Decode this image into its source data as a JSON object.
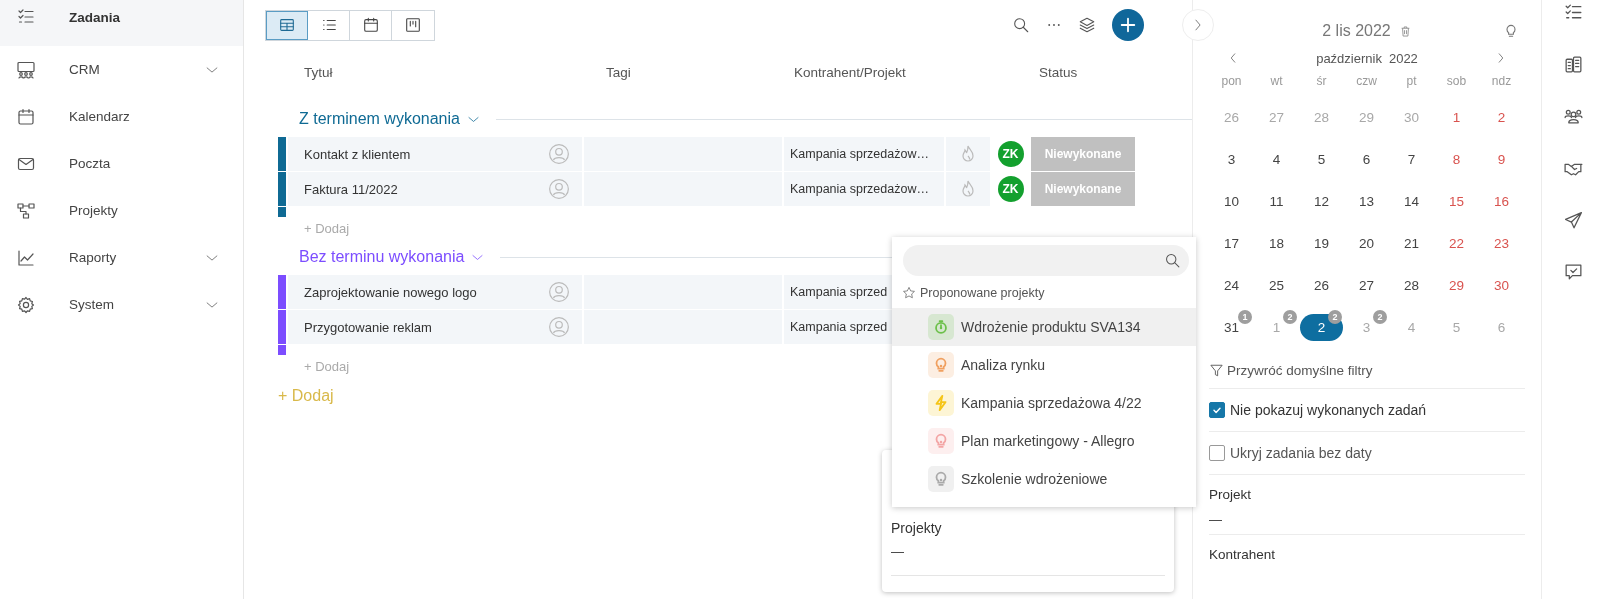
{
  "sidebar": {
    "items": [
      {
        "label": "Zadania",
        "kind": "link",
        "selected": true
      },
      {
        "label": "CRM",
        "kind": "group",
        "selected": false,
        "expanded": false
      },
      {
        "label": "Kalendarz",
        "kind": "link",
        "selected": false
      },
      {
        "label": "Poczta",
        "kind": "link",
        "selected": false
      },
      {
        "label": "Projekty",
        "kind": "link",
        "selected": false
      },
      {
        "label": "Raporty",
        "kind": "group",
        "selected": false,
        "expanded": false
      },
      {
        "label": "System",
        "kind": "group",
        "selected": false,
        "expanded": false
      }
    ]
  },
  "view_modes": [
    {
      "selected": true
    },
    {
      "selected": false
    },
    {
      "selected": false
    },
    {
      "selected": false
    }
  ],
  "table": {
    "columns": [
      "Tytuł",
      "Tagi",
      "Kontrahent/Projekt",
      "Status"
    ],
    "groups": [
      {
        "title": "Z terminem wykonania",
        "color": "#0f6a94",
        "add_label": "+ Dodaj",
        "rows": [
          {
            "title": "Kontakt z klientem",
            "contractor": "Kampania sprzedażow…",
            "assignee": "ZK",
            "status": "Niewykonane"
          },
          {
            "title": "Faktura 11/2022",
            "contractor": "Kampania sprzedażow…",
            "assignee": "ZK",
            "status": "Niewykonane"
          }
        ]
      },
      {
        "title": "Bez terminu wykonania",
        "color": "#7c4dff",
        "add_label": "+ Dodaj",
        "rows": [
          {
            "title": "Zaprojektowanie nowego logo",
            "contractor": "Kampania sprzed"
          },
          {
            "title": "Przygotowanie reklam",
            "contractor": "Kampania sprzed"
          }
        ]
      }
    ],
    "add_group_label": "+ Dodaj"
  },
  "project_card": {
    "label": "Projekty",
    "value": "—"
  },
  "project_picker": {
    "section_title": "Proponowane projekty",
    "items": [
      {
        "label": "Wdrożenie produktu SVA134",
        "kind": "timer",
        "color": "#6cc04a",
        "selected": true
      },
      {
        "label": "Analiza rynku",
        "kind": "bulb",
        "color": "#f0a060",
        "selected": false
      },
      {
        "label": "Kampania sprzedażowa 4/22",
        "kind": "bolt",
        "color": "#f5c518",
        "selected": false
      },
      {
        "label": "Plan marketingowy - Allegro",
        "kind": "bulb",
        "color": "#f3a5a5",
        "selected": false
      },
      {
        "label": "Szkolenie wdrożeniowe",
        "kind": "bulb",
        "color": "#aaaaaa",
        "selected": false
      }
    ]
  },
  "filters": {
    "date": "2 lis 2022",
    "month": "październik",
    "year": "2022",
    "weekdays": [
      "pon",
      "wt",
      "śr",
      "czw",
      "pt",
      "sob",
      "ndz"
    ],
    "days": [
      {
        "day": "26",
        "kind": "outside",
        "selected": false
      },
      {
        "day": "27",
        "kind": "outside",
        "selected": false
      },
      {
        "day": "28",
        "kind": "outside",
        "selected": false
      },
      {
        "day": "29",
        "kind": "outside",
        "selected": false
      },
      {
        "day": "30",
        "kind": "outside",
        "selected": false
      },
      {
        "day": "1",
        "kind": "weekend",
        "selected": false
      },
      {
        "day": "2",
        "kind": "weekend",
        "selected": false
      },
      {
        "day": "3",
        "kind": "weekday",
        "selected": false
      },
      {
        "day": "4",
        "kind": "weekday",
        "selected": false
      },
      {
        "day": "5",
        "kind": "weekday",
        "selected": false
      },
      {
        "day": "6",
        "kind": "weekday",
        "selected": false
      },
      {
        "day": "7",
        "kind": "weekday",
        "selected": false
      },
      {
        "day": "8",
        "kind": "weekend",
        "selected": false
      },
      {
        "day": "9",
        "kind": "weekend",
        "selected": false
      },
      {
        "day": "10",
        "kind": "weekday",
        "selected": false
      },
      {
        "day": "11",
        "kind": "weekday",
        "selected": false
      },
      {
        "day": "12",
        "kind": "weekday",
        "selected": false
      },
      {
        "day": "13",
        "kind": "weekday",
        "selected": false
      },
      {
        "day": "14",
        "kind": "weekday",
        "selected": false
      },
      {
        "day": "15",
        "kind": "weekend",
        "selected": false
      },
      {
        "day": "16",
        "kind": "weekend",
        "selected": false
      },
      {
        "day": "17",
        "kind": "weekday",
        "selected": false
      },
      {
        "day": "18",
        "kind": "weekday",
        "selected": false
      },
      {
        "day": "19",
        "kind": "weekday",
        "selected": false
      },
      {
        "day": "20",
        "kind": "weekday",
        "selected": false
      },
      {
        "day": "21",
        "kind": "weekday",
        "selected": false
      },
      {
        "day": "22",
        "kind": "weekend",
        "selected": false
      },
      {
        "day": "23",
        "kind": "weekend",
        "selected": false
      },
      {
        "day": "24",
        "kind": "weekday",
        "selected": false
      },
      {
        "day": "25",
        "kind": "weekday",
        "selected": false
      },
      {
        "day": "26",
        "kind": "weekday",
        "selected": false
      },
      {
        "day": "27",
        "kind": "weekday",
        "selected": false
      },
      {
        "day": "28",
        "kind": "weekday",
        "selected": false
      },
      {
        "day": "29",
        "kind": "weekend",
        "selected": false
      },
      {
        "day": "30",
        "kind": "weekend",
        "selected": false
      },
      {
        "day": "31",
        "kind": "weekday",
        "selected": false,
        "badge": "1"
      },
      {
        "day": "1",
        "kind": "outside",
        "selected": false,
        "badge": "2"
      },
      {
        "day": "2",
        "kind": "outside",
        "selected": true,
        "badge": "2"
      },
      {
        "day": "3",
        "kind": "outside",
        "selected": false,
        "badge": "2"
      },
      {
        "day": "4",
        "kind": "outside",
        "selected": false
      },
      {
        "day": "5",
        "kind": "outside",
        "selected": false
      },
      {
        "day": "6",
        "kind": "outside",
        "selected": false
      }
    ],
    "reset": "Przywróć domyślne filtry",
    "options": [
      {
        "label": "Nie pokazuj wykonanych zadań",
        "checked": true
      },
      {
        "label": "Ukryj zadania bez daty",
        "checked": false
      }
    ],
    "fields": [
      {
        "label": "Projekt",
        "value": "—"
      },
      {
        "label": "Kontrahent"
      }
    ]
  }
}
